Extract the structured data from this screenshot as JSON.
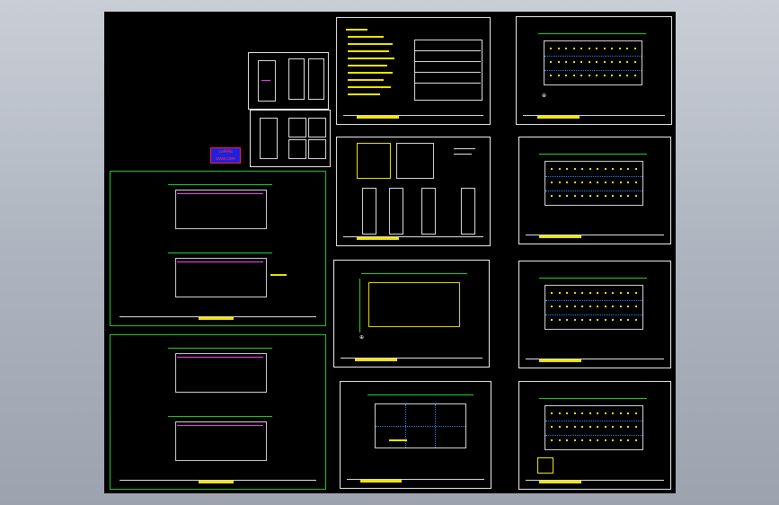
{
  "viewer": {
    "background_color": "#000000",
    "frame_gradient": [
      "#c9ced6",
      "#9ca3ae"
    ]
  },
  "stamp": {
    "line1": "Lo4t4a",
    "line2": "www.com"
  },
  "colors": {
    "sheet_border_white": "#e8e8e8",
    "sheet_border_green": "#21c421",
    "text_yellow": "#f2e400",
    "grid_blue": "#2d86ff",
    "wire_magenta": "#ff3dff"
  },
  "icons": [
    "north-arrow-icon",
    "section-symbol-icon"
  ],
  "sheets": [
    {
      "id": "detail-sheet-a"
    },
    {
      "id": "detail-sheet-b"
    },
    {
      "id": "design-notes-sheet"
    },
    {
      "id": "legend-table-sheet"
    },
    {
      "id": "system-diagram-sheet"
    },
    {
      "id": "floor-plan-dual-1"
    },
    {
      "id": "floor-plan-dual-2"
    },
    {
      "id": "grid-plan-1"
    },
    {
      "id": "grid-plan-2"
    },
    {
      "id": "lighting-plan-1"
    },
    {
      "id": "lighting-plan-2"
    },
    {
      "id": "lighting-plan-3"
    },
    {
      "id": "lighting-plan-4"
    }
  ]
}
